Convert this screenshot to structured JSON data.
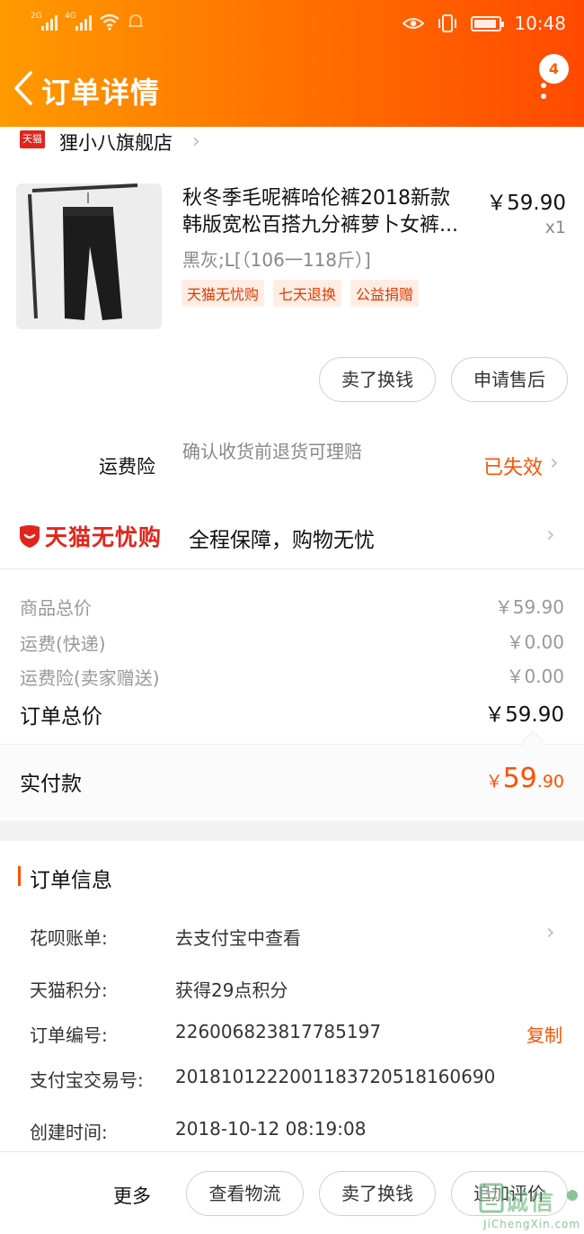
{
  "status_bar": {
    "signal1": "2G",
    "signal2": "4G",
    "time": "10:48"
  },
  "nav": {
    "title": "订单详情",
    "badge": "4"
  },
  "shop": {
    "logo_text": "天猫",
    "name": "狸小八旗舰店"
  },
  "product": {
    "title_line1": "秋冬季毛呢裤哈伦裤2018新款",
    "title_line2": "韩版宽松百搭九分裤萝卜女裤...",
    "price": "￥59.90",
    "qty": "x1",
    "sku": "黑灰;L[（106一118斤）]",
    "tags": [
      "天猫无忧购",
      "七天退换",
      "公益捐赠"
    ]
  },
  "item_actions": {
    "sell": "卖了换钱",
    "after_sales": "申请售后"
  },
  "insurance": {
    "label": "运费险",
    "desc": "确认收货前退货可理赔",
    "status": "已失效"
  },
  "tmall_worry_free": {
    "brand": "天猫无忧购",
    "slogan": "全程保障，购物无忧"
  },
  "costs": [
    {
      "label": "商品总价",
      "value": "￥59.90"
    },
    {
      "label": "运费(快递)",
      "value": "￥0.00"
    },
    {
      "label": "运费险(卖家赠送)",
      "value": "￥0.00"
    }
  ],
  "total": {
    "label": "订单总价",
    "value": "￥59.90"
  },
  "paid": {
    "label": "实付款",
    "currency": "￥",
    "integer": "59",
    "decimal": ".90"
  },
  "order_info": {
    "title": "订单信息",
    "rows": [
      {
        "label": "花呗账单:",
        "value": "去支付宝中查看"
      },
      {
        "label": "天猫积分:",
        "value": "获得29点积分"
      },
      {
        "label": "订单编号:",
        "value": "226006823817785197"
      },
      {
        "label": "支付宝交易号:",
        "value": "2018101222001183720518160690"
      },
      {
        "label": "创建时间:",
        "value": "2018-10-12 08:19:08"
      }
    ],
    "copy_label": "复制"
  },
  "bottom_bar": {
    "more": "更多",
    "logistics": "查看物流",
    "sell": "卖了换钱",
    "review": "追加评价"
  },
  "watermark": {
    "text": "诚信",
    "sub": "JiChengXin.com"
  },
  "colors": {
    "header_start": "#ff9a00",
    "header_end": "#ff4a00",
    "accent": "#ff5000",
    "tmall_red": "#e1251b"
  }
}
